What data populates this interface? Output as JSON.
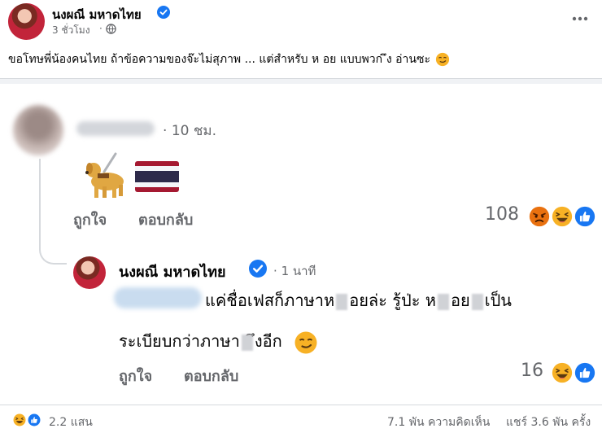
{
  "post": {
    "author": "นงผณี มหาดไทย",
    "time": "3 ชั่วโมง",
    "separator": "·",
    "text": "ขอโทษพี่น้องคนไทย ถ้าข้อความของจ๊ะไม่สุภาพ ... แต่สำหรับ ห  อย แบบพวก ึง อ่านซะ",
    "more_icon": "more-dots-icon",
    "privacy_icon": "globe-icon"
  },
  "comment1": {
    "time": "10 ชม.",
    "like_label": "ถูกใจ",
    "reply_label": "ตอบกลับ",
    "reaction_count": "108",
    "reactions": [
      "angry",
      "haha",
      "like"
    ]
  },
  "comment2": {
    "author": "นงผณี มหาดไทย",
    "time_prefix": "·",
    "time": "1 นาที",
    "line1_a": "แค่ชื่อเฟสก็ภาษาห",
    "line1_b": "อยล่ะ รู้ป่ะ ห",
    "line1_c": "อย",
    "line1_d": "เป็น",
    "line2_a": "ระเบียบกว่าภาษา",
    "line2_b": "ึงอีก",
    "like_label": "ถูกใจ",
    "reply_label": "ตอบกลับ",
    "reaction_count": "16",
    "reactions": [
      "haha",
      "like"
    ]
  },
  "footer": {
    "reactions_count": "2.2 แสน",
    "comments": "7.1 พัน ความคิดเห็น",
    "shares": "แชร์ 3.6 พัน ครั้ง",
    "reactions": [
      "haha",
      "like"
    ]
  },
  "colors": {
    "facebook_blue": "#1877f2",
    "secondary_text": "#65676b",
    "haha_yellow": "#f7b125",
    "angry_red": "#e9710f"
  }
}
